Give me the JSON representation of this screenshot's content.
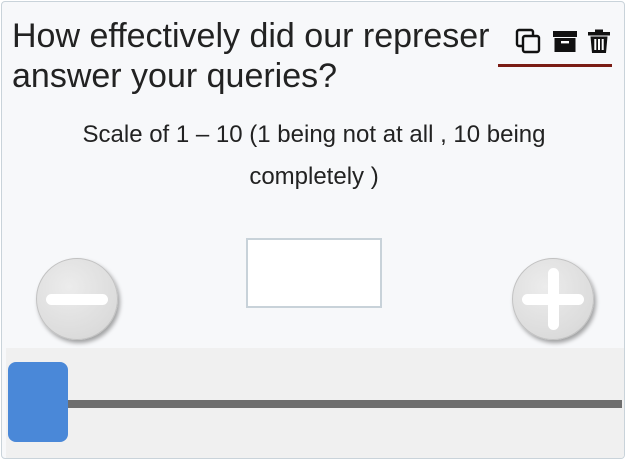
{
  "question": {
    "line1": "How effectively did our represer",
    "line2": "answer your queries?"
  },
  "toolbar": {
    "copy_icon": "copy-icon",
    "archive_icon": "archive-icon",
    "trash_icon": "trash-icon",
    "underline_color": "#7a1c14"
  },
  "scale": {
    "line1": "Scale of 1 – 10 (1 being not at all , 10 being",
    "line2": "completely )"
  },
  "stepper": {
    "decrement_icon": "minus-icon",
    "increment_icon": "plus-icon",
    "value": ""
  },
  "slider": {
    "min": 1,
    "max": 10,
    "position_fraction": 0,
    "thumb_color": "#4a88d8",
    "track_color": "#6e6e6e"
  }
}
